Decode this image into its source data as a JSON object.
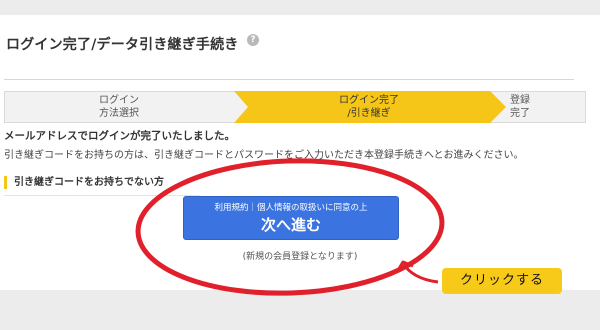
{
  "header": {
    "title": "ログイン完了/データ引き継ぎ手続き",
    "help_icon": "question-circle-icon"
  },
  "stepper": {
    "steps": [
      {
        "line1": "ログイン",
        "line2": "方法選択",
        "state": "done"
      },
      {
        "line1": "ログイン完了",
        "line2": "/引き継ぎ",
        "state": "current"
      },
      {
        "line1": "登録",
        "line2": "完了",
        "state": "upcoming"
      }
    ],
    "active_color": "#f5c518"
  },
  "notice": {
    "title": "メールアドレスでログインが完了いたしました。",
    "text": "引き継ぎコードをお持ちの方は、引き継ぎコードとパスワードをご入力いただき本登録手続きへとお進みください。"
  },
  "no_code_section": {
    "heading": "引き継ぎコードをお持ちでない方",
    "button_sub": "利用規約｜個人情報の取扱いに同意の上",
    "button_main": "次へ進む",
    "note": "(新規の会員登録となります)"
  },
  "annotation": {
    "callout": "クリックする",
    "circle_color": "#e0202a",
    "callout_color": "#f7c919"
  }
}
